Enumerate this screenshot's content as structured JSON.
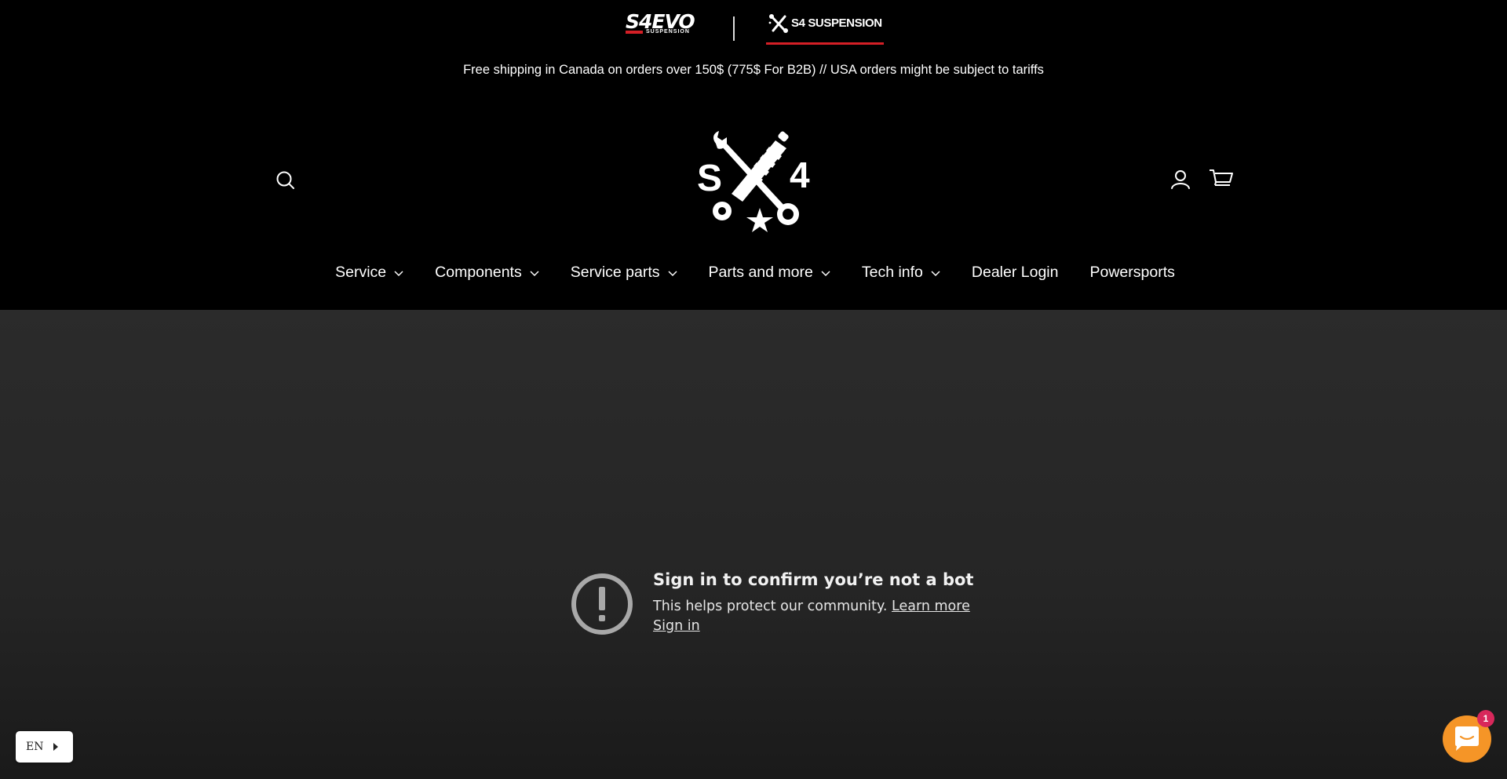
{
  "brand_switcher": {
    "evo_logo": {
      "word": "S4EVO",
      "sub": "SUSPENSION"
    },
    "s4_logo": {
      "word": "S4 SUSPENSION",
      "icon": "wrench-shock-icon"
    }
  },
  "announcement": "Free shipping in Canada on orders over 150$ (775$ For B2B) // USA orders might be subject to tariffs",
  "header": {
    "search_icon": "search-icon",
    "logo": {
      "left": "S",
      "right": "4",
      "icon": "wrench-shock-star-logo"
    },
    "account_icon": "user-icon",
    "cart_icon": "cart-icon"
  },
  "nav": {
    "items": [
      {
        "label": "Service",
        "dropdown": true
      },
      {
        "label": "Components",
        "dropdown": true
      },
      {
        "label": "Service parts",
        "dropdown": true
      },
      {
        "label": "Parts and more",
        "dropdown": true
      },
      {
        "label": "Tech info",
        "dropdown": true
      },
      {
        "label": "Dealer Login",
        "dropdown": false
      },
      {
        "label": "Powersports",
        "dropdown": false
      }
    ]
  },
  "bot_check": {
    "icon": "exclamation-circle-icon",
    "title": "Sign in to confirm you’re not a bot",
    "text": "This helps protect our community.",
    "learn_more": "Learn more",
    "sign_in": "Sign in"
  },
  "language": {
    "selected": "EN"
  },
  "chat": {
    "icon": "chat-bubble-icon",
    "badge": "1",
    "color": "#f59527"
  },
  "colors": {
    "accent_red": "#d41f26",
    "background": "#000000",
    "badge": "#d8285b"
  }
}
